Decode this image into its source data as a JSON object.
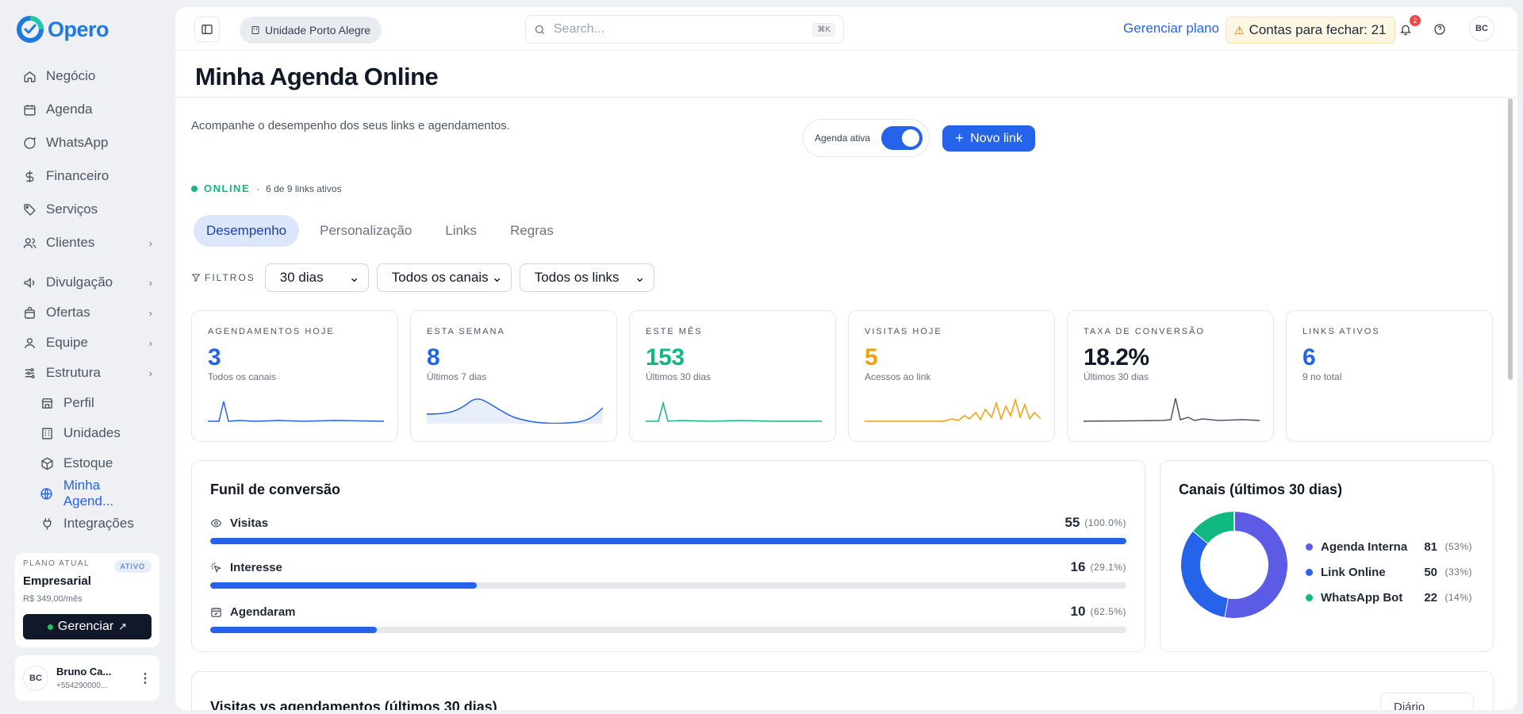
{
  "app": {
    "logo_text": "Opero",
    "accent": "#2563eb",
    "logo_accent": "#1f7ae0"
  },
  "sidebar": {
    "items": [
      {
        "label": "Negócio",
        "icon": "home-icon"
      },
      {
        "label": "Agenda",
        "icon": "calendar-icon"
      },
      {
        "label": "WhatsApp",
        "icon": "chat-icon"
      },
      {
        "label": "Financeiro",
        "icon": "dollar-icon"
      },
      {
        "label": "Serviços",
        "icon": "tag-icon"
      },
      {
        "label": "Clientes",
        "icon": "users-icon"
      },
      {
        "label": "Divulgação",
        "icon": "megaphone-icon"
      },
      {
        "label": "Ofertas",
        "icon": "shopping-bag-icon"
      },
      {
        "label": "Equipe",
        "icon": "user-icon"
      },
      {
        "label": "Estrutura",
        "icon": "sliders-icon"
      }
    ],
    "sub_items": [
      {
        "label": "Perfil",
        "icon": "store-icon"
      },
      {
        "label": "Unidades",
        "icon": "building-icon"
      },
      {
        "label": "Estoque",
        "icon": "box-icon"
      },
      {
        "label": "Minha Agend...",
        "icon": "globe-icon",
        "active": true
      },
      {
        "label": "Integrações",
        "icon": "plug-icon"
      }
    ],
    "plan": {
      "label": "PLANO ATUAL",
      "badge": "ATIVO",
      "name": "Empresarial",
      "price": "R$ 349,00/mês",
      "button": "Gerenciar"
    },
    "user": {
      "initials": "BC",
      "name": "Bruno Ca...",
      "phone": "+554290000..."
    }
  },
  "topbar": {
    "unit": "Unidade Porto Alegre",
    "search_placeholder": "Search...",
    "search_kbd": "⌘K",
    "manage_plan": "Gerenciar plano",
    "contas": "Contas para fechar: 21",
    "notifications_count": "2",
    "avatar": "BC"
  },
  "page": {
    "title": "Minha Agenda Online",
    "subtitle": "Acompanhe o desempenho dos seus links e agendamentos.",
    "toggle_label": "Agenda ativa",
    "toggle_on": true,
    "new_link": "Novo link",
    "status": "ONLINE",
    "status_sep": "·",
    "status_detail": "6 de 9 links ativos"
  },
  "tabs": [
    "Desempenho",
    "Personalização",
    "Links",
    "Regras"
  ],
  "filters": {
    "label": "FILTROS",
    "period": "30 dias",
    "channels": "Todos os canais",
    "links": "Todos os links"
  },
  "kpis": [
    {
      "label": "AGENDAMENTOS HOJE",
      "value": "3",
      "sub": "Todos os canais",
      "color": "#2563eb"
    },
    {
      "label": "ESTA SEMANA",
      "value": "8",
      "sub": "Últimos 7 dias",
      "color": "#2563eb"
    },
    {
      "label": "ESTE MÊS",
      "value": "153",
      "sub": "Últimos 30 dias",
      "color": "#10b981"
    },
    {
      "label": "VISITAS HOJE",
      "value": "5",
      "sub": "Acessos ao link",
      "color": "#f59e0b"
    },
    {
      "label": "TAXA DE CONVERSÃO",
      "value": "18.2%",
      "sub": "Últimos 30 dias",
      "color": "#111827"
    },
    {
      "label": "LINKS ATIVOS",
      "value": "6",
      "sub": "9 no total",
      "color": "#2563eb"
    }
  ],
  "funnel": {
    "title": "Funil de conversão",
    "steps": [
      {
        "label": "Visitas",
        "value": "55",
        "pct": "(100.0%)",
        "fraction": 1.0,
        "icon": "eye-icon"
      },
      {
        "label": "Interesse",
        "value": "16",
        "pct": "(29.1%)",
        "fraction": 0.291,
        "icon": "pointer-click-icon"
      },
      {
        "label": "Agendaram",
        "value": "10",
        "pct": "(62.5%)",
        "fraction": 0.182,
        "icon": "calendar-check-icon"
      }
    ]
  },
  "channels": {
    "title": "Canais (últimos 30 dias)",
    "items": [
      {
        "name": "Agenda Interna",
        "value": "81",
        "pct": "(53%)",
        "color": "#5b5be6",
        "share": 53
      },
      {
        "name": "Link Online",
        "value": "50",
        "pct": "(33%)",
        "color": "#2563eb",
        "share": 33
      },
      {
        "name": "WhatsApp Bot",
        "value": "22",
        "pct": "(14%)",
        "color": "#10b981",
        "share": 14
      }
    ]
  },
  "bottom": {
    "title": "Visitas vs agendamentos (últimos 30 dias)",
    "button": "Diário"
  }
}
